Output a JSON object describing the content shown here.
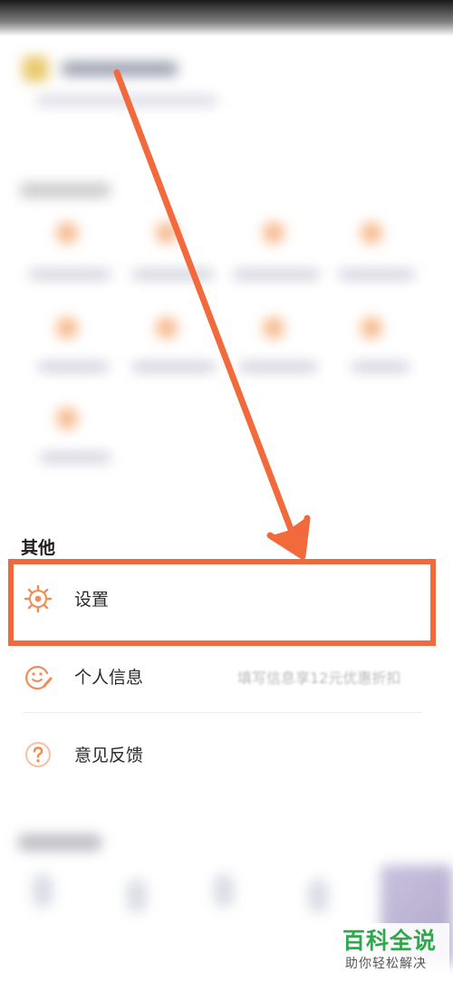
{
  "status_bar": {},
  "other_section": {
    "title": "其他",
    "items": [
      {
        "label": "设置",
        "icon": "gear-icon"
      },
      {
        "label": "个人信息",
        "icon": "face-edit-icon",
        "hint": "填写信息享12元优惠折扣"
      },
      {
        "label": "意见反馈",
        "icon": "question-icon"
      }
    ]
  },
  "watermark": {
    "main": "百科全说",
    "sub": "助你轻松解决"
  },
  "colors": {
    "accent": "#f26a3c",
    "icon_orange": "#f28b56",
    "watermark_green": "#2ea84a"
  }
}
